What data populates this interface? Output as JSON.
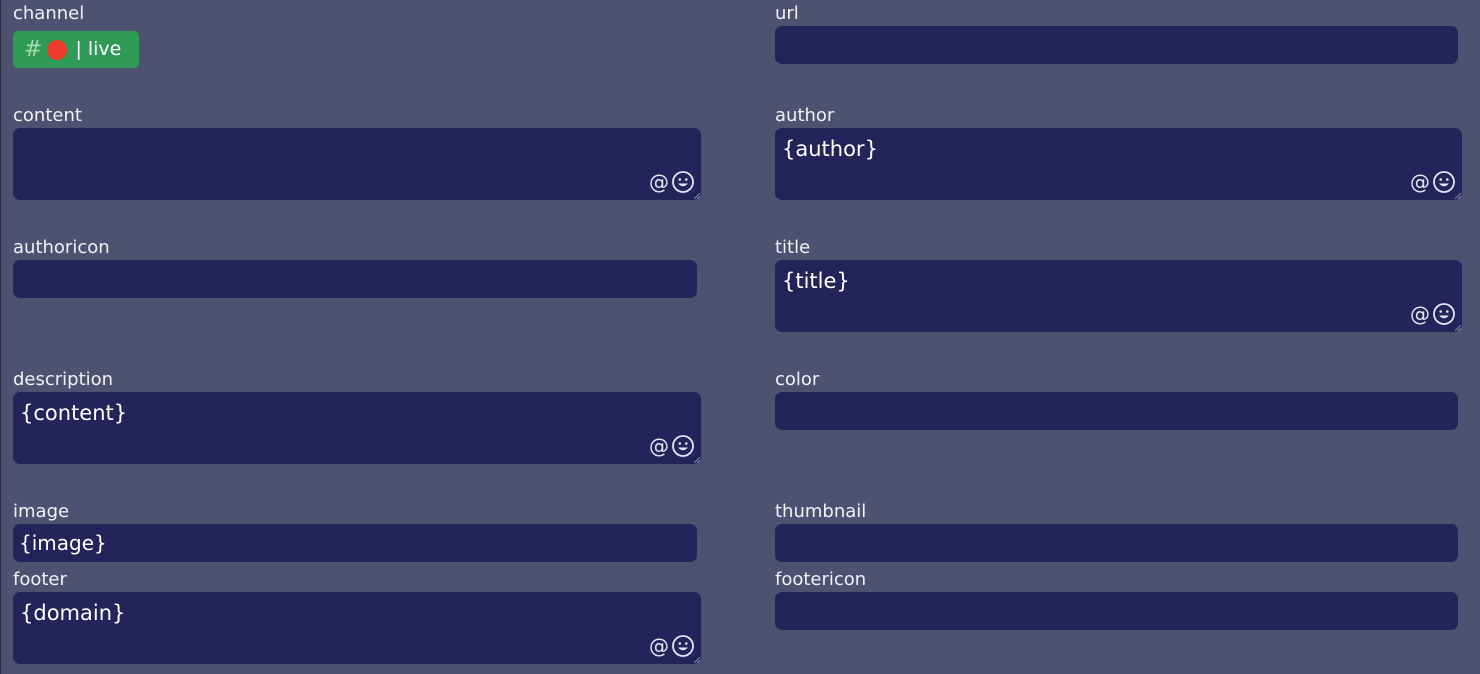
{
  "channel": {
    "label": "channel",
    "hash": "#",
    "status_color": "#ef3b2c",
    "name": "| live",
    "chip_color": "#2e9a55"
  },
  "fields": {
    "url": {
      "label": "url",
      "value": ""
    },
    "content": {
      "label": "content",
      "value": ""
    },
    "author": {
      "label": "author",
      "value": "{author}"
    },
    "authoricon": {
      "label": "authoricon",
      "value": ""
    },
    "title": {
      "label": "title",
      "value": "{title}"
    },
    "description": {
      "label": "description",
      "value": "{content}"
    },
    "color": {
      "label": "color",
      "value": ""
    },
    "image": {
      "label": "image",
      "value": "{image}"
    },
    "thumbnail": {
      "label": "thumbnail",
      "value": ""
    },
    "footer": {
      "label": "footer",
      "value": "{domain}"
    },
    "footericon": {
      "label": "footericon",
      "value": ""
    }
  },
  "tools": {
    "mention": "@",
    "emoji_icon": "emoji-smile-icon"
  },
  "colors": {
    "background": "#4e5170",
    "input": "#24235a",
    "text": "#ffffff"
  }
}
